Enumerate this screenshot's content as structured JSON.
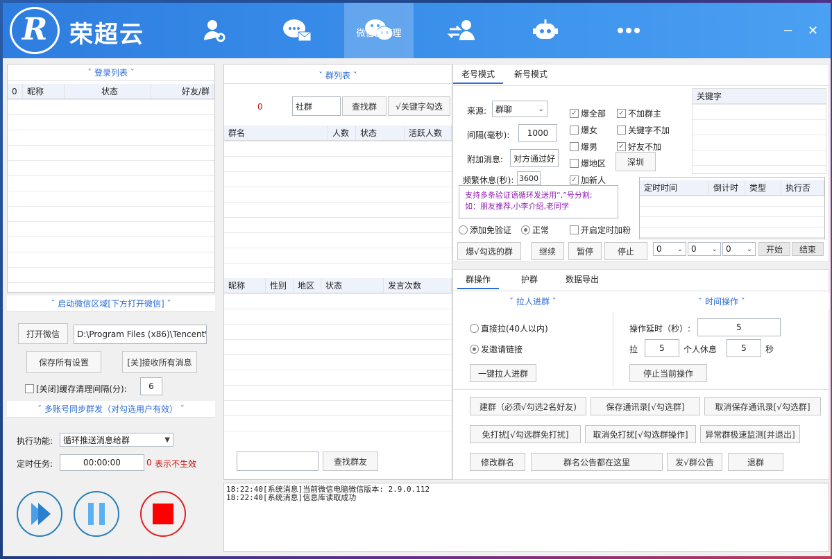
{
  "app": {
    "name": "荣超云",
    "logo_letter": "R"
  },
  "nav": [
    {
      "label": "",
      "icon": "user-gear-icon"
    },
    {
      "label": "",
      "icon": "chat-mail-icon"
    },
    {
      "label": "微信群管理",
      "icon": "wechat-icon"
    },
    {
      "label": "",
      "icon": "users-transfer-icon"
    },
    {
      "label": "",
      "icon": "robot-icon"
    },
    {
      "label": "",
      "icon": "more-icon"
    }
  ],
  "window": {
    "minimize": "−",
    "close": "✕"
  },
  "login": {
    "title": "ˇ 登录列表 ˇ",
    "cols": [
      "0",
      "昵称",
      "状态",
      "好友/群"
    ]
  },
  "startwx": {
    "title": "ˇ 启动微信区域[下方打开微信] ˇ",
    "open_btn": "打开微信",
    "path": "D:\\Program Files (x86)\\Tencent\\",
    "save_btn": "保存所有设置",
    "recv_btn": "[关]接收所有消息",
    "cache_label": "[关闭]缓存清理间隔(分):",
    "cache_value": "6"
  },
  "multi": {
    "title": "ˇ 多账号同步群发（对勾选用户有效） ˇ",
    "func_label": "执行功能:",
    "func_value": "循环推送消息给群",
    "timer_label": "定时任务:",
    "timer_value": "00:00:00",
    "timer_zero": "0",
    "timer_hint": "表示不生效"
  },
  "group": {
    "title": "ˇ 群列表 ˇ",
    "count": "0",
    "search_value": "社群",
    "find_btn": "查找群",
    "kw_btn": "√关键字勾选",
    "cols": [
      "群名",
      "人数",
      "状态",
      "活跃人数"
    ],
    "member_cols": [
      "昵称",
      "性别",
      "地区",
      "状态",
      "发言次数"
    ],
    "find_friend_btn": "查找群友"
  },
  "mode": {
    "tabs": [
      "老号模式",
      "新号模式"
    ],
    "source_label": "来源:",
    "source_value": "群聊",
    "interval_label": "间隔(毫秒):",
    "interval_value": "1000",
    "extra_label": "附加消息:",
    "extra_value": "对方通过好",
    "freq_label": "频繁休息(秒):",
    "freq_value": "3600",
    "chk_all": "爆全部",
    "chk_female": "爆女",
    "chk_male": "爆男",
    "chk_region": "爆地区",
    "region_value": "深圳",
    "chk_new": "加新人",
    "chk_nojoin": "不加群主",
    "chk_kw_no": "关键字不加",
    "chk_friend_no": "好友不加",
    "hint": "支持多条验证语循环发送用“,”号分割;\n如：朋友推荐,小李介绍,老同学",
    "radio_free": "添加免验证",
    "radio_normal": "正常",
    "chk_timer": "开启定时加粉",
    "burst_btn": "爆√勾选的群",
    "continue_btn": "继续",
    "pause_btn": "暂停",
    "stop_btn": "停止",
    "kw_title": "关键字",
    "timer_cols": [
      "定时时间",
      "倒计时",
      "类型",
      "执行否"
    ],
    "sel1": "0",
    "sel2": "0",
    "sel3": "0",
    "start_btn": "开始",
    "end_btn": "结束"
  },
  "ops": {
    "tabs": [
      "群操作",
      "护群",
      "数据导出"
    ],
    "pull_title": "ˇ 拉人进群 ˇ",
    "time_title": "ˇ 时间操作 ˇ",
    "radio_direct": "直接拉(40人以内)",
    "radio_invite": "发邀请链接",
    "pull_btn": "一键拉人进群",
    "delay_label": "操作延时（秒）:",
    "delay_value": "5",
    "pull_label": "拉",
    "pull_value": "5",
    "rest_label": "个人休息",
    "rest_value": "5",
    "sec_label": "秒",
    "stop_op_btn": "停止当前操作",
    "b1": "建群（必须√勾选2名好友)",
    "b2": "保存通讯录[√勾选群]",
    "b3": "取消保存通讯录[√勾选群]",
    "b4": "免打扰[√勾选群免打扰]",
    "b5": "取消免打扰[√勾选群操作]",
    "b6": "异常群极速监测[并退出]",
    "b7": "修改群名",
    "b8": "群名公告都在这里",
    "b9": "发√群公告",
    "b10": "退群"
  },
  "log": [
    "18:22:40[系统消息]当前微信电脑微信版本: 2.9.0.112",
    "18:22:40[系统消息]信息库读取成功"
  ]
}
